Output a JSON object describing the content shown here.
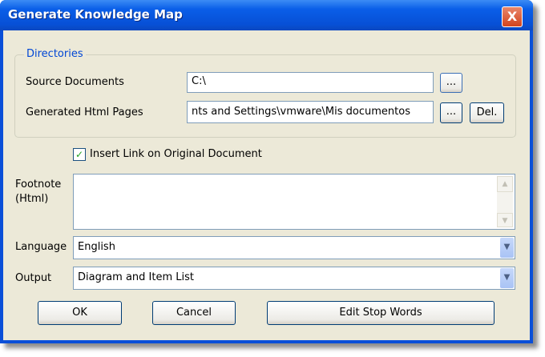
{
  "window": {
    "title": "Generate Knowledge Map",
    "close_label": "X"
  },
  "directories": {
    "group_label": "Directories",
    "source": {
      "label": "Source Documents",
      "value": "C:\\",
      "browse_label": "..."
    },
    "generated": {
      "label": "Generated Html Pages",
      "value": "nts and Settings\\vmware\\Mis documentos",
      "browse_label": "...",
      "delete_label": "Del."
    }
  },
  "insert_link": {
    "label": "Insert Link on Original Document",
    "checked": true,
    "check_glyph": "✓"
  },
  "footnote": {
    "label_line1": "Footnote",
    "label_line2": "(Html)",
    "value": ""
  },
  "language": {
    "label": "Language",
    "value": "English"
  },
  "output": {
    "label": "Output",
    "value": "Diagram and Item List"
  },
  "buttons": {
    "ok": "OK",
    "cancel": "Cancel",
    "edit_stop_words": "Edit Stop Words"
  }
}
